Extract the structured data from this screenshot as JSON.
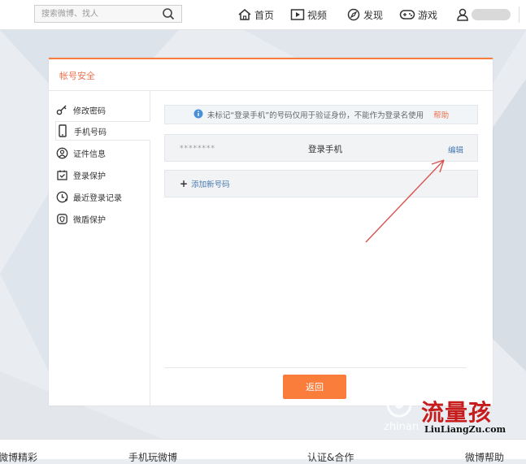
{
  "topbar": {
    "search_placeholder": "搜索微博、找人",
    "nav": [
      {
        "label": "首页",
        "icon": "home-icon"
      },
      {
        "label": "视频",
        "icon": "video-icon"
      },
      {
        "label": "发现",
        "icon": "compass-icon"
      },
      {
        "label": "游戏",
        "icon": "gamepad-icon"
      }
    ],
    "user_icon": "user-icon"
  },
  "panel": {
    "title": "帐号安全",
    "accent_color": "#fa7d3c",
    "sidebar": [
      {
        "label": "修改密码",
        "icon": "key-icon",
        "active": false
      },
      {
        "label": "手机号码",
        "icon": "phone-icon",
        "active": true
      },
      {
        "label": "证件信息",
        "icon": "id-card-icon",
        "active": false
      },
      {
        "label": "登录保护",
        "icon": "login-protect-icon",
        "active": false
      },
      {
        "label": "最近登录记录",
        "icon": "recent-login-icon",
        "active": false
      },
      {
        "label": "微盾保护",
        "icon": "shield-icon",
        "active": false
      }
    ],
    "notice": {
      "text": "未标记“登录手机”的号码仅用于验证身份，不能作为登录名使用",
      "help": "帮助"
    },
    "phone": {
      "number": "********",
      "type": "登录手机",
      "edit": "编辑"
    },
    "add_label": "添加新号码",
    "return_label": "返回"
  },
  "footer": {
    "items": [
      "微博精彩",
      "手机玩微博",
      "认证&合作",
      "微博帮助"
    ]
  },
  "watermark": {
    "site_cn": "流量孩",
    "site_url": "LiuLiangZu.com",
    "site2": "zhinan"
  }
}
